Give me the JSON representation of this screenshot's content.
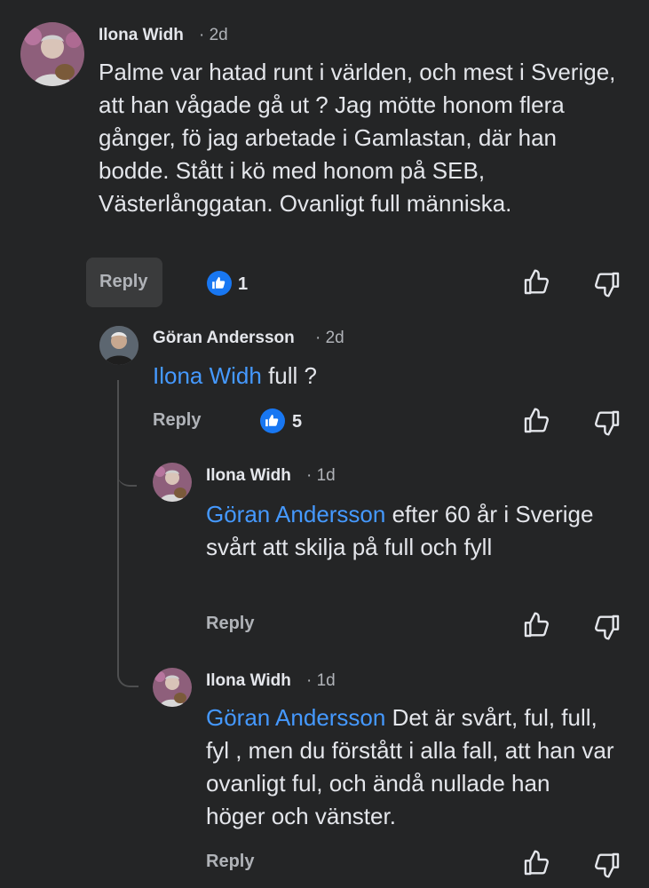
{
  "comments": [
    {
      "author": "Ilona Widh",
      "time": "· 2d",
      "text": "Palme var hatad runt i världen, och mest i Sverige, att han vågade gå ut ? Jag mötte honom flera gånger, fö jag arbetade i Gamlastan, där han bodde. Stått i kö med honom på SEB, Västerlånggatan. Ovanligt full människa.",
      "reply_label": "Reply",
      "like_count": "1"
    },
    {
      "author": "Göran Andersson",
      "time": "· 2d",
      "mention": "Ilona Widh",
      "text": " full ?",
      "reply_label": "Reply",
      "like_count": "5"
    },
    {
      "author": "Ilona Widh",
      "time": "· 1d",
      "mention": "Göran Andersson",
      "text": " efter 60 år i Sverige svårt att skilja på full och fyll",
      "reply_label": "Reply"
    },
    {
      "author": "Ilona Widh",
      "time": "· 1d",
      "mention": "Göran Andersson",
      "text": " Det är svårt, ful, full, fyl , men du förstått i alla fall, att han var ovanligt ful, och ändå nullade han höger och vänster.",
      "reply_label": "Reply"
    }
  ],
  "icons": {
    "like": "thumbs-up-icon",
    "dislike": "thumbs-down-icon",
    "reaction": "like-reaction-icon"
  },
  "colors": {
    "background": "#242526",
    "mention": "#4599ff",
    "like_badge": "#1877f2"
  }
}
